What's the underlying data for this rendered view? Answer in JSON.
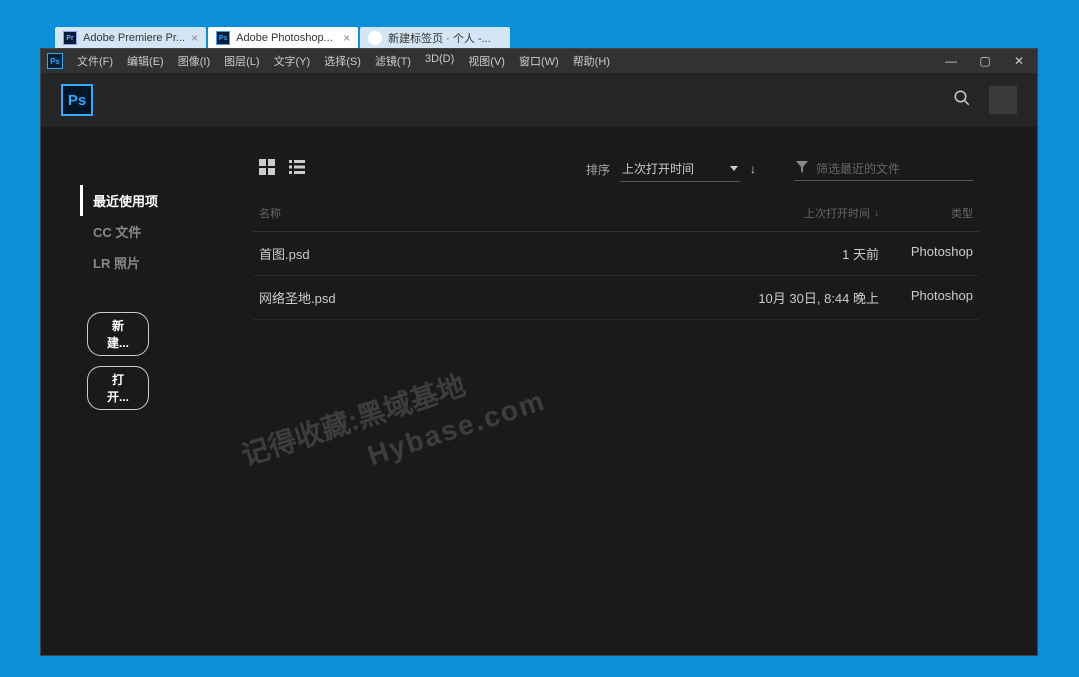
{
  "browser_tabs": [
    {
      "icon": "Pr",
      "title": "Adobe Premiere Pr..."
    },
    {
      "icon": "Ps",
      "title": "Adobe Photoshop..."
    },
    {
      "icon": "●",
      "title": "新建标签页 · 个人 -..."
    }
  ],
  "menu": [
    "文件(F)",
    "编辑(E)",
    "图像(I)",
    "图层(L)",
    "文字(Y)",
    "选择(S)",
    "滤镜(T)",
    "3D(D)",
    "视图(V)",
    "窗口(W)",
    "帮助(H)"
  ],
  "ps_logo_text": "Ps",
  "sidebar": {
    "items": [
      "最近使用项",
      "CC 文件",
      "LR 照片"
    ],
    "buttons": {
      "new": "新建...",
      "open": "打开..."
    }
  },
  "toolbar": {
    "sort_label": "排序",
    "sort_value": "上次打开时间",
    "filter_placeholder": "筛选最近的文件"
  },
  "table": {
    "headers": {
      "name": "名称",
      "date": "上次打开时间",
      "type": "类型"
    },
    "rows": [
      {
        "name": "首图.psd",
        "date": "1 天前",
        "type": "Photoshop"
      },
      {
        "name": "网络圣地.psd",
        "date": "10月 30日, 8:44 晚上",
        "type": "Photoshop"
      }
    ]
  },
  "watermark": {
    "line1": "记得收藏:黑域基地",
    "line2": "Hybase.com"
  }
}
